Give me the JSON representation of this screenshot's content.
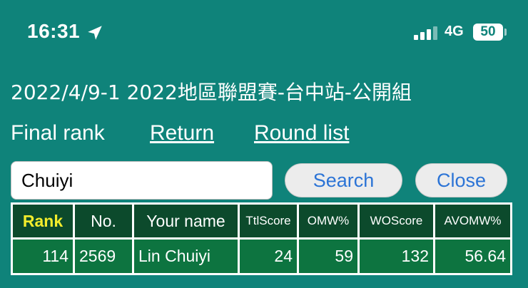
{
  "status_bar": {
    "time": "16:31",
    "network": "4G",
    "battery": "50"
  },
  "event_title": "2022/4/9-1 2022地區聯盟賽-台中站-公開組",
  "nav": {
    "final_rank": "Final rank",
    "return": "Return",
    "round_list": "Round list"
  },
  "search": {
    "value": "Chuiyi",
    "search_label": "Search",
    "close_label": "Close"
  },
  "table": {
    "headers": [
      "Rank",
      "No.",
      "Your name",
      "TtlScore",
      "OMW%",
      "WOScore",
      "AVOMW%"
    ],
    "rows": [
      [
        "114",
        "2569",
        "Lin Chuiyi",
        "24",
        "59",
        "132",
        "56.64"
      ]
    ]
  },
  "colors": {
    "background": "#0f837a",
    "header_cell": "#0c4a2c",
    "row_cell": "#0d7440",
    "rank_header": "#f3ec2c",
    "button_text": "#2c74d6"
  }
}
